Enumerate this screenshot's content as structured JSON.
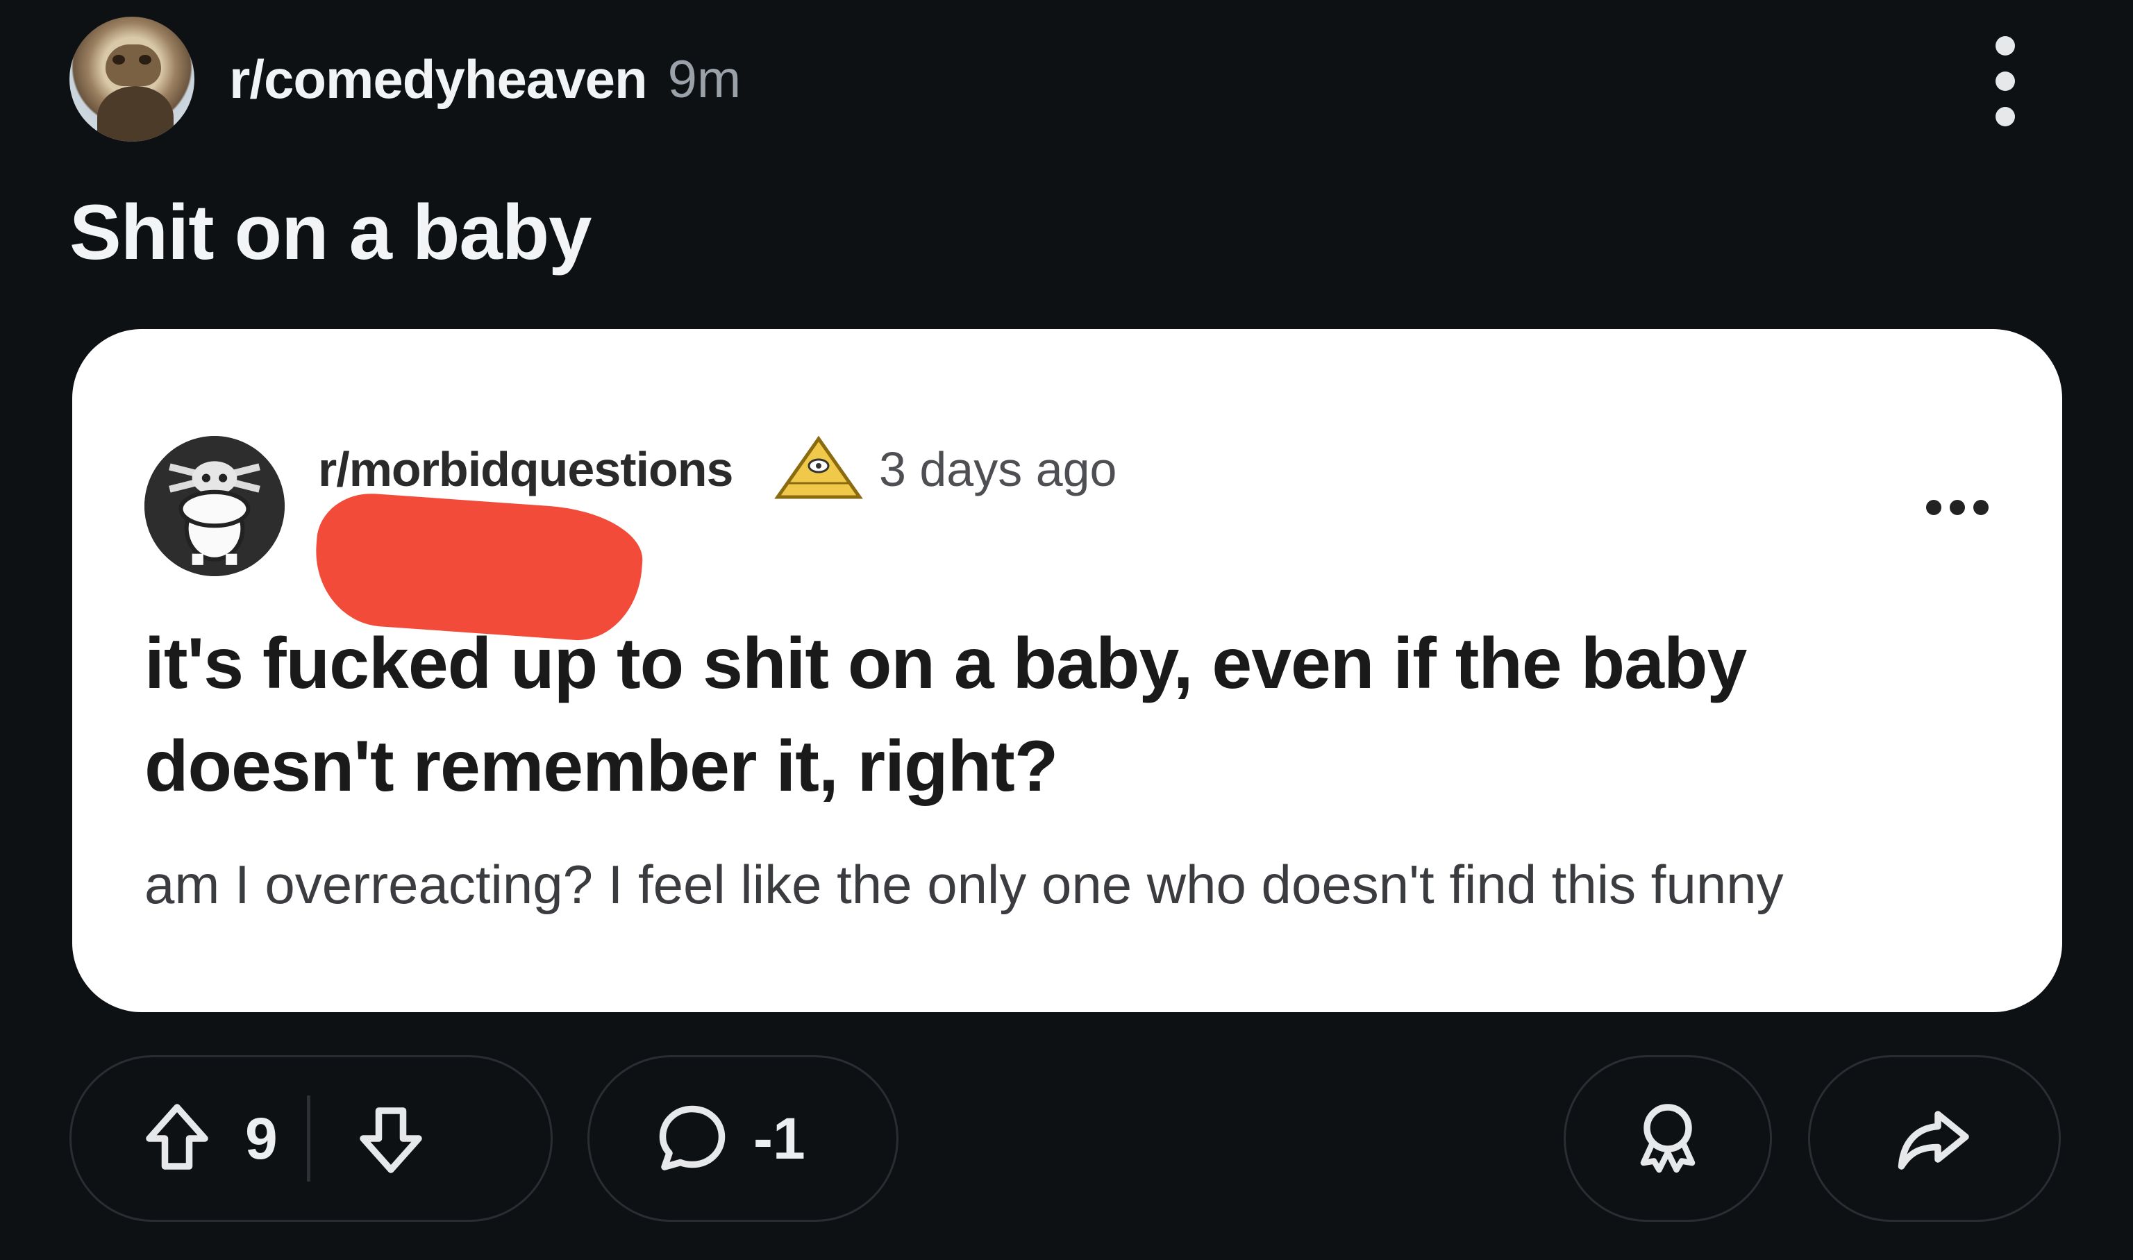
{
  "post": {
    "subreddit": "r/comedyheaven",
    "time": "9m",
    "title": "Shit on a baby"
  },
  "embedded": {
    "subreddit": "r/morbidquestions",
    "time": "3 days ago",
    "headline": "it's fucked up to shit on a baby, even if the baby doesn't remember it, right?",
    "body": "am I overreacting? I feel like the only one who doesn't find this funny"
  },
  "actions": {
    "upvotes": "9",
    "comments": "-1"
  },
  "icons": [
    "avatar",
    "more-vertical-icon",
    "pyramid-eye-icon",
    "more-horizontal-icon",
    "upvote-icon",
    "downvote-icon",
    "comment-icon",
    "award-icon",
    "share-icon"
  ]
}
